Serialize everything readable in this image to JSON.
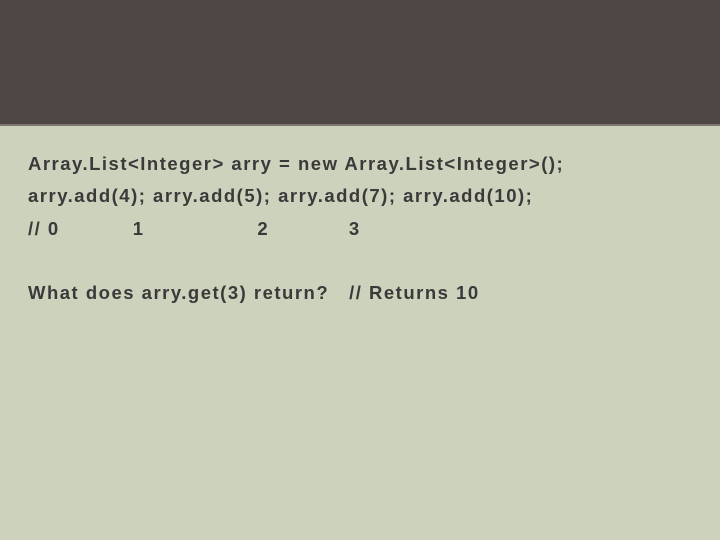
{
  "code": {
    "line1": "Array.List<Integer> arry = new Array.List<Integer>();",
    "line2": "arry.add(4); arry.add(5); arry.add(7); arry.add(10);",
    "line3": "// 0           1                 2            3"
  },
  "question": "What does arry.get(3) return?",
  "answer": "// Returns 10"
}
